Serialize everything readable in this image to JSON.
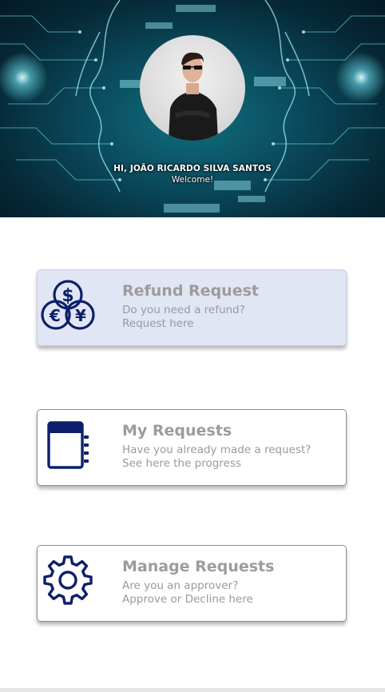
{
  "header": {
    "greeting": "HI, JOÃO RICARDO SILVA SANTOS",
    "welcome": "Welcome!"
  },
  "menu": [
    {
      "title": "Refund Request",
      "line1": "Do you need a refund?",
      "line2": "Request here",
      "icon": "currency-coins-icon",
      "active": true
    },
    {
      "title": "My Requests",
      "line1": "Have you already made a request?",
      "line2": "See here the progress",
      "icon": "notebook-icon",
      "active": false
    },
    {
      "title": "Manage Requests",
      "line1": "Are you an approver?",
      "line2": "Approve or Decline here",
      "icon": "gear-icon",
      "active": false
    }
  ],
  "colors": {
    "icon": "#0c1f6b",
    "active_card": "#e1e6f4",
    "card_text": "#9c9c9c"
  }
}
